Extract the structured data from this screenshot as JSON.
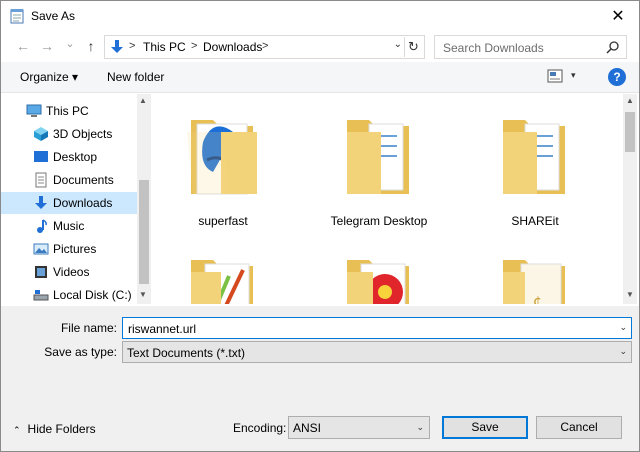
{
  "window": {
    "title": "Save As",
    "close_glyph": "✕"
  },
  "nav": {
    "back_glyph": "←",
    "forward_glyph": "→",
    "recent_glyph": "⌄",
    "up_glyph": "↑"
  },
  "address": {
    "crumbs": [
      "This PC",
      "Downloads"
    ],
    "separator": ">",
    "dropdown_glyph": "⌄",
    "refresh_glyph": "↻"
  },
  "search": {
    "placeholder": "Search Downloads"
  },
  "toolbar": {
    "organize_label": "Organize ▾",
    "new_folder_label": "New folder",
    "view_dropdown_glyph": "▾",
    "help_label": "?"
  },
  "sidebar": {
    "items": [
      {
        "label": "This PC",
        "icon": "computer-icon"
      },
      {
        "label": "3D Objects",
        "icon": "cube-icon"
      },
      {
        "label": "Desktop",
        "icon": "desktop-icon"
      },
      {
        "label": "Documents",
        "icon": "document-icon"
      },
      {
        "label": "Downloads",
        "icon": "download-icon",
        "selected": true
      },
      {
        "label": "Music",
        "icon": "music-icon"
      },
      {
        "label": "Pictures",
        "icon": "pictures-icon"
      },
      {
        "label": "Videos",
        "icon": "videos-icon"
      },
      {
        "label": "Local Disk (C:)",
        "icon": "disk-icon"
      }
    ],
    "scroll_up_glyph": "▲",
    "scroll_down_glyph": "▼"
  },
  "folders": [
    {
      "name": "superfast"
    },
    {
      "name": "Telegram Desktop"
    },
    {
      "name": "SHAREit"
    },
    {
      "name": ""
    },
    {
      "name": ""
    },
    {
      "name": ""
    }
  ],
  "form": {
    "file_name_label": "File name:",
    "file_name_value": "riswannet.url",
    "save_as_type_label": "Save as type:",
    "save_as_type_value": "Text Documents (*.txt)",
    "dropdown_glyph": "⌄"
  },
  "footer": {
    "hide_folders_caret": "⌃",
    "hide_folders_label": "Hide Folders",
    "encoding_label": "Encoding:",
    "encoding_value": "ANSI",
    "save_label": "Save",
    "cancel_label": "Cancel"
  },
  "colors": {
    "accent": "#0078d7",
    "selection": "#cce8ff",
    "folder": "#f3d37a",
    "help": "#1f6fd6"
  }
}
